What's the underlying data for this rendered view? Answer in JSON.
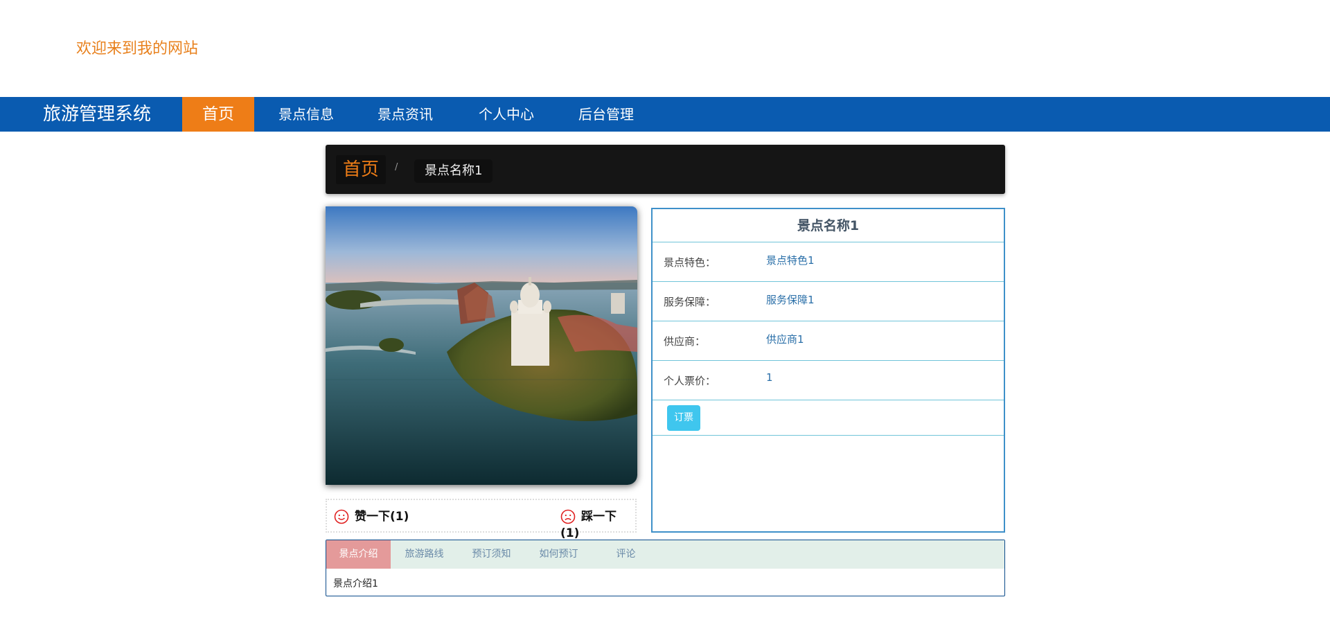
{
  "header": {
    "welcome": "欢迎来到我的网站"
  },
  "nav": {
    "brand": "旅游管理系统",
    "items": [
      {
        "label": "首页",
        "active": true
      },
      {
        "label": "景点信息",
        "active": false
      },
      {
        "label": "景点资讯",
        "active": false
      },
      {
        "label": "个人中心",
        "active": false
      },
      {
        "label": "后台管理",
        "active": false
      }
    ]
  },
  "breadcrumb": {
    "home": "首页",
    "separator": "/",
    "current": "景点名称1"
  },
  "votes": {
    "like": "赞一下(1)",
    "dislike": "踩一下(1)"
  },
  "details": {
    "title": "景点名称1",
    "rows": [
      {
        "label": "景点特色：",
        "value": "景点特色1"
      },
      {
        "label": "服务保障：",
        "value": "服务保障1"
      },
      {
        "label": "供应商：",
        "value": "供应商1"
      },
      {
        "label": "个人票价：",
        "value": "1"
      }
    ],
    "order_button": "订票"
  },
  "tabs": {
    "items": [
      {
        "label": "景点介绍",
        "active": true
      },
      {
        "label": "旅游路线",
        "active": false
      },
      {
        "label": "预订须知",
        "active": false
      },
      {
        "label": "如何预订",
        "active": false
      },
      {
        "label": "评论",
        "active": false
      }
    ],
    "content": "景点介绍1"
  },
  "colors": {
    "nav_bg": "#0a5bb0",
    "accent": "#ee7d17",
    "info_border": "#3e90c9",
    "order_button": "#3fc6ee",
    "active_tab": "#e49a9a",
    "vote_icon": "#e02020"
  }
}
